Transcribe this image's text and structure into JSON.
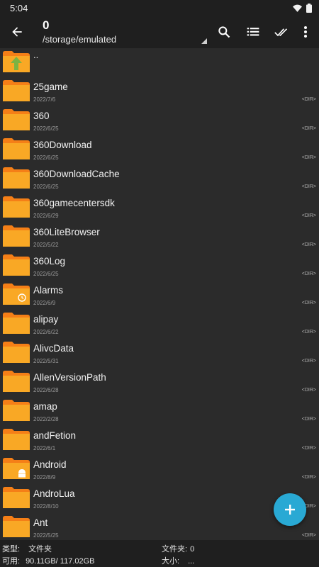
{
  "status_bar": {
    "time": "5:04"
  },
  "toolbar": {
    "count": "0",
    "path": "/storage/emulated"
  },
  "parent_entry": {
    "name": ".."
  },
  "files": [
    {
      "name": "25game",
      "date": "2022/7/6",
      "type": "<DIR>",
      "badge": ""
    },
    {
      "name": "360",
      "date": "2022/6/25",
      "type": "<DIR>",
      "badge": ""
    },
    {
      "name": "360Download",
      "date": "2022/6/25",
      "type": "<DIR>",
      "badge": ""
    },
    {
      "name": "360DownloadCache",
      "date": "2022/6/25",
      "type": "<DIR>",
      "badge": ""
    },
    {
      "name": "360gamecentersdk",
      "date": "2022/6/29",
      "type": "<DIR>",
      "badge": ""
    },
    {
      "name": "360LiteBrowser",
      "date": "2022/5/22",
      "type": "<DIR>",
      "badge": ""
    },
    {
      "name": "360Log",
      "date": "2022/6/25",
      "type": "<DIR>",
      "badge": ""
    },
    {
      "name": "Alarms",
      "date": "2022/6/9",
      "type": "<DIR>",
      "badge": "alarm"
    },
    {
      "name": "alipay",
      "date": "2022/6/22",
      "type": "<DIR>",
      "badge": ""
    },
    {
      "name": "AlivcData",
      "date": "2022/5/31",
      "type": "<DIR>",
      "badge": ""
    },
    {
      "name": "AllenVersionPath",
      "date": "2022/6/28",
      "type": "<DIR>",
      "badge": ""
    },
    {
      "name": "amap",
      "date": "2022/2/28",
      "type": "<DIR>",
      "badge": ""
    },
    {
      "name": "andFetion",
      "date": "2022/6/1",
      "type": "<DIR>",
      "badge": ""
    },
    {
      "name": "Android",
      "date": "2022/8/9",
      "type": "<DIR>",
      "badge": "android"
    },
    {
      "name": "AndroLua",
      "date": "2022/8/10",
      "type": "<DIR>",
      "badge": ""
    },
    {
      "name": "Ant",
      "date": "2022/5/25",
      "type": "<DIR>",
      "badge": ""
    }
  ],
  "footer": {
    "type_label": "类型:",
    "type_value": "文件夹",
    "folder_label": "文件夹:",
    "folder_value": "0",
    "avail_label": "可用:",
    "avail_value": "90.11GB/ 117.02GB",
    "size_label": "大小:",
    "size_value": "..."
  },
  "colors": {
    "folder": "#f9a825",
    "folder_tab": "#f57f17",
    "accent": "#29a9d4",
    "up_arrow": "#7cb342"
  },
  "icons": [
    "back-arrow-icon",
    "search-icon",
    "list-view-icon",
    "double-check-icon",
    "more-vert-icon",
    "folder-icon",
    "plus-icon"
  ]
}
